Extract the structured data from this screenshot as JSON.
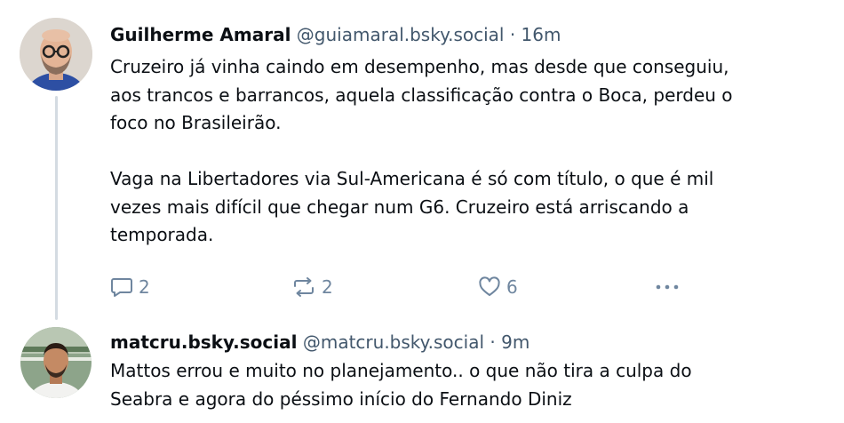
{
  "posts": [
    {
      "author": "Guilherme Amaral",
      "handle": "@guiamaral.bsky.social",
      "separator": "·",
      "time": "16m",
      "text": "Cruzeiro já vinha caindo em desempenho, mas desde que conseguiu,\naos trancos e barrancos, aquela classificação contra o Boca, perdeu o\nfoco no Brasileirão.\n\nVaga na Libertadores via Sul-Americana é só com título, o que é mil\nvezes mais difícil que chegar num G6. Cruzeiro está arriscando a\ntemporada.",
      "replies": "2",
      "reposts": "2",
      "likes": "6"
    },
    {
      "author": "matcru.bsky.social",
      "handle": "@matcru.bsky.social",
      "separator": "·",
      "time": "9m",
      "text": "Mattos errou e muito no planejamento.. o que não tira a culpa do\nSeabra e agora do péssimo início do Fernando Diniz"
    }
  ],
  "icons": {
    "reply": "reply-icon",
    "repost": "repost-icon",
    "like": "heart-icon",
    "more": "more-horizontal-icon"
  },
  "colors": {
    "text": "#0b0f14",
    "meta": "#42576c",
    "icon": "#6f869f",
    "thread_line": "#d4dbe2"
  }
}
